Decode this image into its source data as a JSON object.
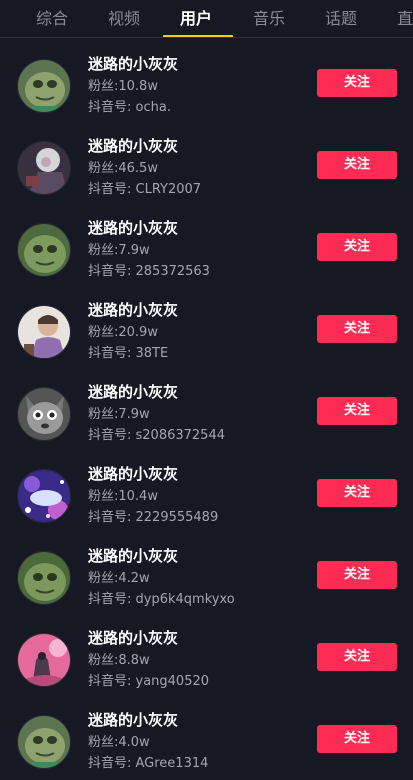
{
  "tabs": [
    {
      "label": "综合",
      "active": false
    },
    {
      "label": "视频",
      "active": false
    },
    {
      "label": "用户",
      "active": true
    },
    {
      "label": "音乐",
      "active": false
    },
    {
      "label": "话题",
      "active": false
    },
    {
      "label": "直",
      "active": false
    }
  ],
  "colors": {
    "background": "#161823",
    "accent_underline": "#face15",
    "follow_button": "#fe2c55",
    "secondary_text": "#a5a6ab"
  },
  "users": [
    {
      "name": "迷路的小灰灰",
      "fans": "粉丝:10.8w",
      "douyin_id": "抖音号: ocha.",
      "follow_label": "关注",
      "avatar": "green-frog-face"
    },
    {
      "name": "迷路的小灰灰",
      "fans": "粉丝:46.5w",
      "douyin_id": "抖音号: CLRY2007",
      "follow_label": "关注",
      "avatar": "anime-character"
    },
    {
      "name": "迷路的小灰灰",
      "fans": "粉丝:7.9w",
      "douyin_id": "抖音号: 285372563",
      "follow_label": "关注",
      "avatar": "green-frog-face"
    },
    {
      "name": "迷路的小灰灰",
      "fans": "粉丝:20.9w",
      "douyin_id": "抖音号: 38TE",
      "follow_label": "关注",
      "avatar": "person-photo"
    },
    {
      "name": "迷路的小灰灰",
      "fans": "粉丝:7.9w",
      "douyin_id": "抖音号: s2086372544",
      "follow_label": "关注",
      "avatar": "grey-wolf-cartoon"
    },
    {
      "name": "迷路的小灰灰",
      "fans": "粉丝:10.4w",
      "douyin_id": "抖音号: 2229555489",
      "follow_label": "关注",
      "avatar": "purple-galaxy-art"
    },
    {
      "name": "迷路的小灰灰",
      "fans": "粉丝:4.2w",
      "douyin_id": "抖音号: dyp6k4qmkyxo",
      "follow_label": "关注",
      "avatar": "green-frog-face"
    },
    {
      "name": "迷路的小灰灰",
      "fans": "粉丝:8.8w",
      "douyin_id": "抖音号: yang40520",
      "follow_label": "关注",
      "avatar": "pink-monster-art"
    },
    {
      "name": "迷路的小灰灰",
      "fans": "粉丝:4.0w",
      "douyin_id": "抖音号: AGree1314",
      "follow_label": "关注",
      "avatar": "green-frog-face"
    }
  ]
}
